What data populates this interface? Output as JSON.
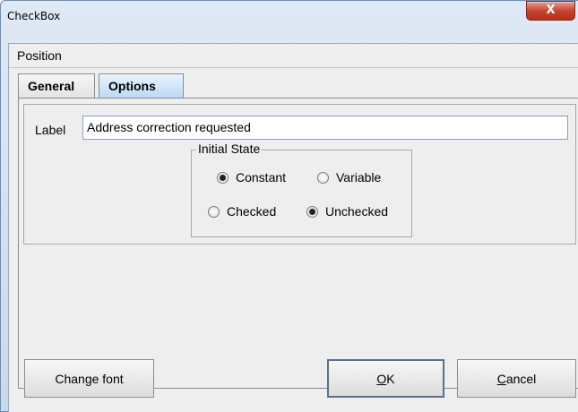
{
  "window": {
    "title": "CheckBox",
    "close_glyph": "X"
  },
  "menu": {
    "items": [
      "Position"
    ]
  },
  "tabs": [
    {
      "label": "General",
      "selected": false
    },
    {
      "label": "Options",
      "selected": true
    }
  ],
  "options": {
    "label_caption": "Label",
    "label_value": "Address correction requested",
    "initial_state": {
      "title": "Initial State",
      "mode_options": [
        {
          "label": "Constant",
          "checked": true
        },
        {
          "label": "Variable",
          "checked": false
        }
      ],
      "value_options": [
        {
          "label": "Checked",
          "checked": false
        },
        {
          "label": "Unchecked",
          "checked": true
        }
      ]
    }
  },
  "buttons": {
    "change_font": "Change font",
    "ok_mnemonic": "O",
    "ok_rest": "K",
    "cancel_mnemonic": "C",
    "cancel_rest": "ancel"
  }
}
